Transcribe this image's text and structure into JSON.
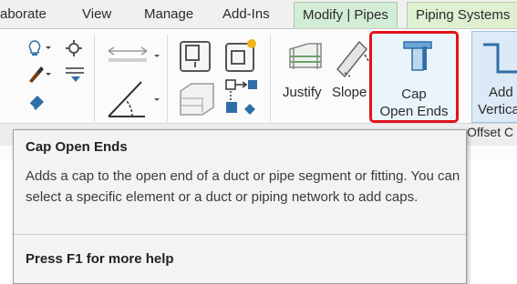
{
  "tabs": [
    {
      "label": "aborate",
      "active": false
    },
    {
      "label": "View",
      "active": false
    },
    {
      "label": "Manage",
      "active": false
    },
    {
      "label": "Add-Ins",
      "active": false
    },
    {
      "label": "Modify | Pipes",
      "active": true
    },
    {
      "label": "Piping Systems",
      "active": false
    }
  ],
  "ribbon": {
    "justify_label": "Justify",
    "slope_label": "Slope",
    "cap_label_line1": "Cap",
    "cap_label_line2": "Open Ends",
    "add_vertical_line1": "Add",
    "add_vertical_line2": "Vertica",
    "offset_panel_label": "Offset C"
  },
  "tooltip": {
    "title": "Cap Open Ends",
    "description": "Adds a cap to the open end of a duct or pipe segment or fitting. You can select a specific element or a duct or piping network to add caps.",
    "help": "Press F1 for more help"
  },
  "colors": {
    "highlight": "#e0141c",
    "active_tab": "#d3ecd5",
    "icon_blue": "#2f6fa8"
  }
}
